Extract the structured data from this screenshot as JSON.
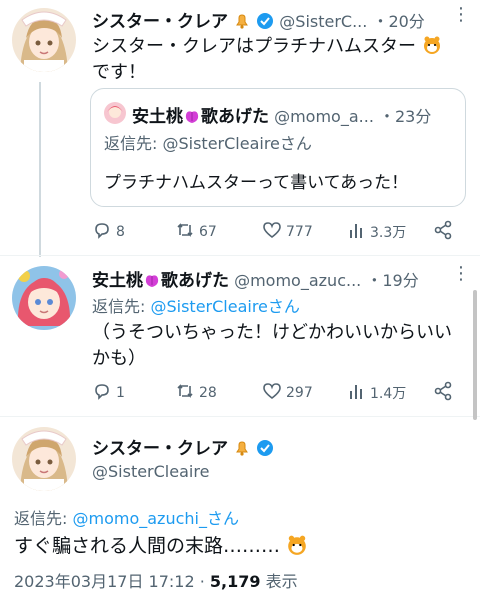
{
  "tweet1": {
    "name": "シスター・クレア",
    "handle": "@SisterC...",
    "time": "・20分",
    "text_line1": "シスター・クレアはプラチナハムスター",
    "text_line2": "です！",
    "quote": {
      "name": "安土桃",
      "name_suffix": "歌あげた",
      "handle": "@momo_a...",
      "time": "・23分",
      "reply_prefix": "返信先: ",
      "reply_to": "@SisterCleaire",
      "reply_suffix": "さん",
      "text": "プラチナハムスターって書いてあった！"
    },
    "actions": {
      "replies": "8",
      "retweets": "67",
      "likes": "777",
      "views": "3.3万"
    }
  },
  "tweet2": {
    "name": "安土桃",
    "name_suffix": "歌あげた",
    "handle": "@momo_azuc...",
    "time": "・19分",
    "reply_prefix": "返信先: ",
    "reply_to": "@SisterCleaire",
    "reply_suffix": "さん",
    "text_line1": "（うそついちゃった！けどかわいいからいい",
    "text_line2": "かも）",
    "actions": {
      "replies": "1",
      "retweets": "28",
      "likes": "297",
      "views": "1.4万"
    }
  },
  "tweet3": {
    "name": "シスター・クレア",
    "handle": "@SisterCleaire",
    "reply_prefix": "返信先: ",
    "reply_to": "@momo_azuchi_さん",
    "text": "すぐ騙される人間の末路………",
    "timestamp": "2023年03月17日 17:12 · ",
    "views_count": "5,179",
    "views_label": " 表示"
  },
  "colors": {
    "accent": "#1d9bf0",
    "muted": "#536471",
    "verified": "#1d9bf0"
  },
  "icons": [
    "bell-icon",
    "verified-badge-icon",
    "hamster-emoji-icon",
    "peach-emoji-icon",
    "reply-icon",
    "retweet-icon",
    "like-icon",
    "views-icon",
    "share-icon",
    "more-icon"
  ]
}
